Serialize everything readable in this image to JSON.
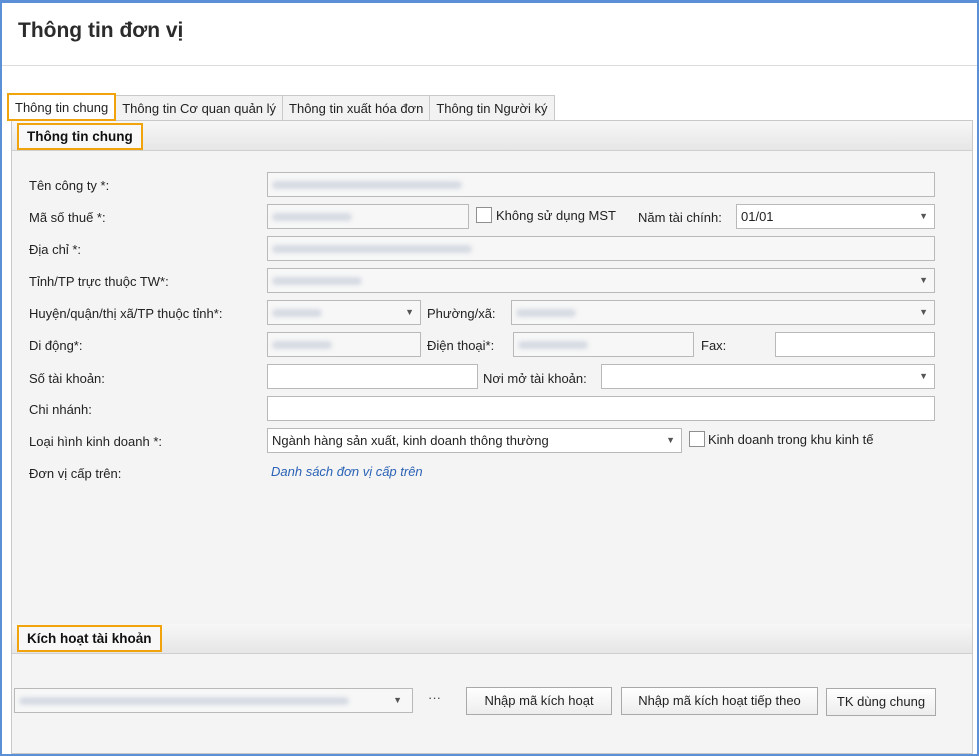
{
  "window": {
    "title": "Thông tin đơn vị"
  },
  "tabs": [
    {
      "label": "Thông tin chung",
      "active": true
    },
    {
      "label": "Thông tin Cơ quan quản lý"
    },
    {
      "label": "Thông tin xuất hóa đơn"
    },
    {
      "label": "Thông tin Người ký"
    }
  ],
  "general": {
    "header": "Thông tin chung",
    "company_name_label": "Tên công ty *:",
    "tax_code_label": "Mã số thuế *:",
    "no_tax_code_label": "Không sử dụng MST",
    "fiscal_year_label": "Năm tài chính:",
    "fiscal_year_value": "01/01",
    "address_label": "Địa chỉ *:",
    "province_label": "Tỉnh/TP trực thuộc TW*:",
    "district_label": "Huyện/quận/thị xã/TP thuộc tỉnh*:",
    "ward_label": "Phường/xã:",
    "mobile_label": "Di động*:",
    "phone_label": "Điện thoại*:",
    "fax_label": "Fax:",
    "account_no_label": "Số tài khoản:",
    "bank_label": "Nơi mở tài khoản:",
    "branch_label": "Chi nhánh:",
    "business_type_label": "Loại hình kinh doanh *:",
    "business_type_value": "Ngành hàng sản xuất, kinh doanh thông thường",
    "economic_zone_label": "Kinh doanh trong khu kinh tế",
    "parent_unit_label": "Đơn vị cấp trên:",
    "parent_unit_link": "Danh sách đơn vị cấp trên"
  },
  "activation": {
    "header": "Kích hoạt tài khoản",
    "ellipsis": "···",
    "enter_code_button": "Nhập mã kích hoạt",
    "enter_next_code_button": "Nhập mã kích hoạt tiếp theo",
    "shared_account_button": "TK dùng chung"
  }
}
